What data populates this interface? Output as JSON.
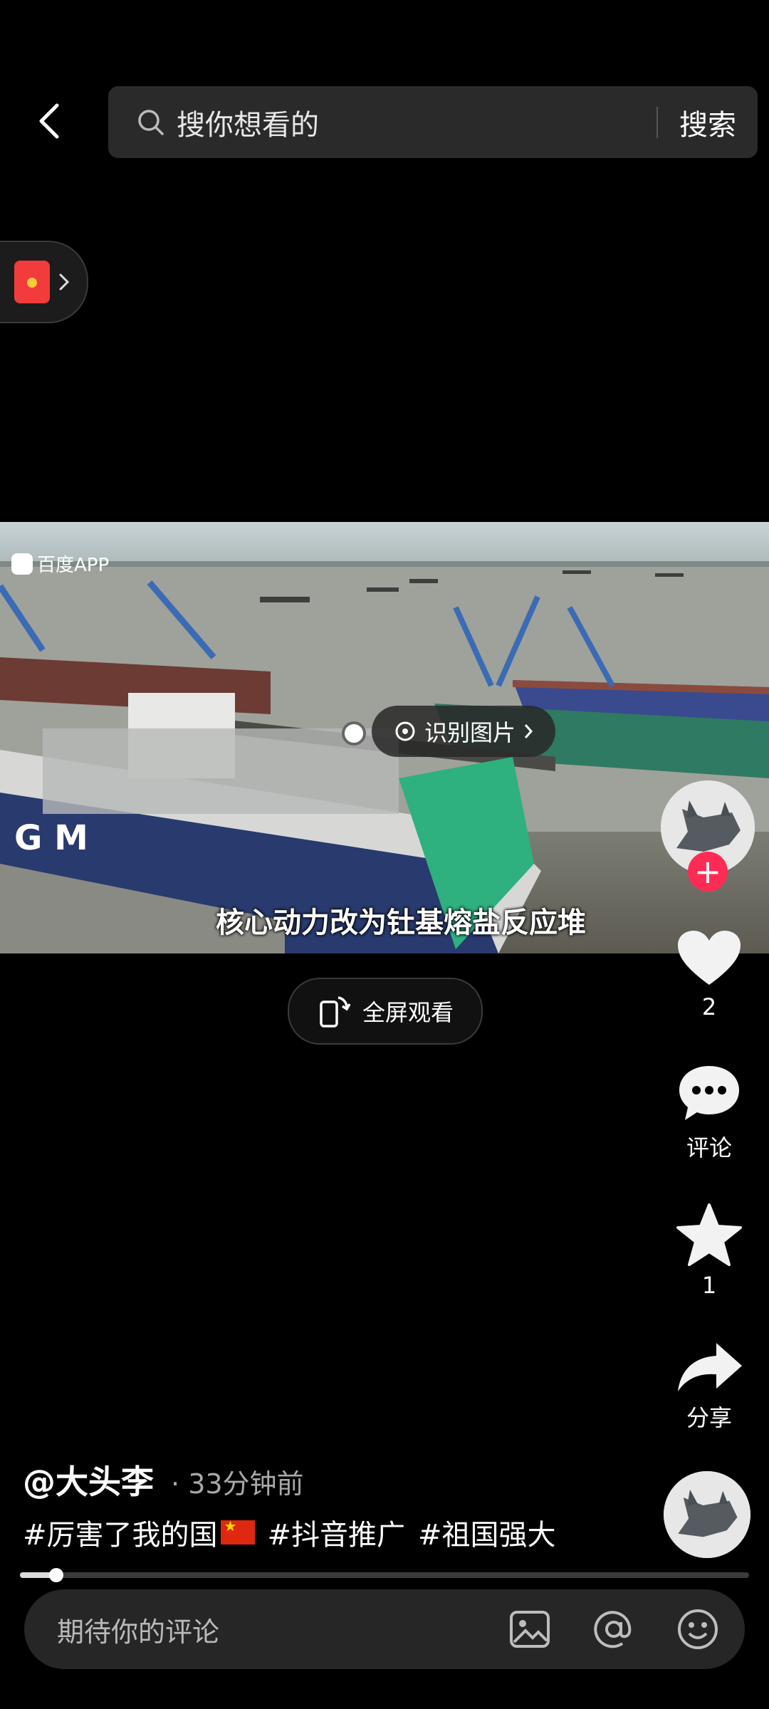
{
  "search": {
    "placeholder": "搜你想看的",
    "button_label": "搜索"
  },
  "video": {
    "watermark": "百度APP",
    "recognize_label": "识别图片",
    "subtitle": "核心动力改为钍基熔盐反应堆"
  },
  "fullscreen_label": "全屏观看",
  "actions": {
    "like_count": "2",
    "comment_label": "评论",
    "favorite_count": "1",
    "share_label": "分享"
  },
  "post": {
    "author": "@大头李",
    "separator": "·",
    "time": "33分钟前",
    "tags": [
      "#厉害了我的国",
      "#抖音推广",
      "#祖国强大"
    ]
  },
  "playback_progress": 0.05,
  "comment_input": {
    "placeholder": "期待你的评论"
  },
  "icons": [
    "back-icon",
    "search-icon",
    "red-packet-icon",
    "chevron-right-icon",
    "recognize-icon",
    "fullscreen-icon",
    "heart-icon",
    "comment-icon",
    "star-icon",
    "share-icon",
    "image-icon",
    "at-icon",
    "emoji-icon"
  ],
  "colors": {
    "accent": "#fe2c55",
    "background": "#000000",
    "search_bg": "#2a2a2a"
  }
}
